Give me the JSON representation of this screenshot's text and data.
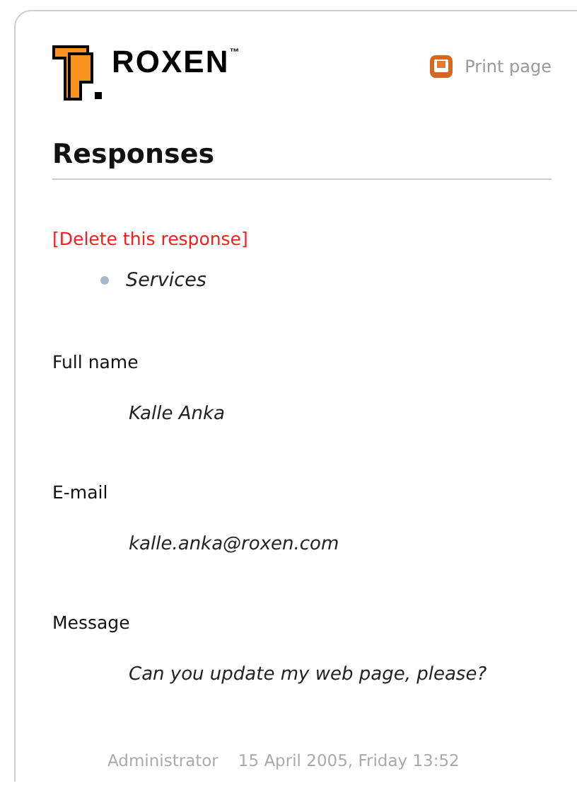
{
  "logo": {
    "text": "ROXEN",
    "mark": "™"
  },
  "print_link": "Print page",
  "heading": "Responses",
  "delete_link": "[Delete this response]",
  "selected_options": [
    "Services"
  ],
  "fields": [
    {
      "label": "Full name",
      "value": "Kalle Anka"
    },
    {
      "label": "E-mail",
      "value": "kalle.anka@roxen.com"
    },
    {
      "label": "Message",
      "value": "Can you update my web page, please?"
    }
  ],
  "footer": {
    "author": "Administrator",
    "date": "15 April 2005, Friday 13:52"
  }
}
